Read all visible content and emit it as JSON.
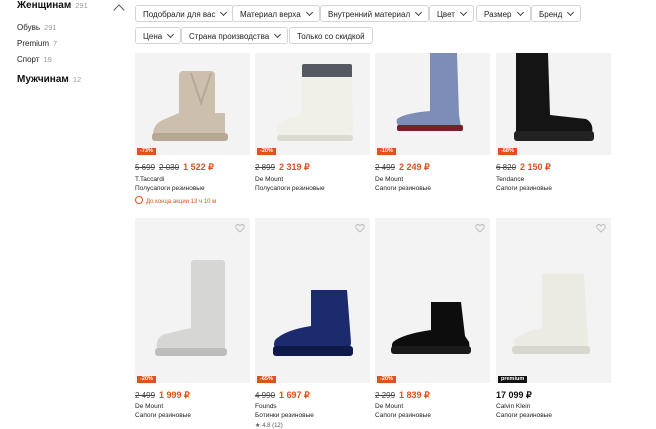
{
  "sidebar": {
    "women": {
      "label": "Женщинам",
      "count": "291"
    },
    "subcats": [
      {
        "label": "Обувь",
        "count": "291"
      },
      {
        "label": "Premium",
        "count": "7"
      },
      {
        "label": "Спорт",
        "count": "19"
      }
    ],
    "men": {
      "label": "Мужчинам",
      "count": "12"
    }
  },
  "filters": [
    {
      "label": "Подобрали для вас"
    },
    {
      "label": "Материал верха"
    },
    {
      "label": "Внутренний материал"
    },
    {
      "label": "Цвет"
    },
    {
      "label": "Размер"
    },
    {
      "label": "Бренд"
    },
    {
      "label": "Цена"
    },
    {
      "label": "Страна производства"
    },
    {
      "label": "Только со скидкой"
    }
  ],
  "products": [
    {
      "badge": "-73%",
      "old_price": "5 699",
      "mid_price": "2 030",
      "price": "1 522 ₽",
      "brand": "T.Taccardi",
      "type": "Полусапоги резиновые",
      "promo": "До конца акции 13 ч 10 м",
      "color": "#cdbfae"
    },
    {
      "badge": "-20%",
      "old_price": "2 899",
      "price": "2 319 ₽",
      "brand": "De Mount",
      "type": "Полусапоги резиновые",
      "color": "#f0efe8"
    },
    {
      "badge": "-10%",
      "old_price": "2 499",
      "price": "2 249 ₽",
      "brand": "De Mount",
      "type": "Сапоги резиновые",
      "color": "#7e8db8"
    },
    {
      "badge": "-68%",
      "old_price": "6 820",
      "price": "2 150 ₽",
      "brand": "Tendance",
      "type": "Сапоги резиновые",
      "color": "#141414"
    },
    {
      "badge": "-20%",
      "old_price": "2 499",
      "price": "1 999 ₽",
      "brand": "De Mount",
      "type": "Сапоги резиновые",
      "color": "#d6d6d4"
    },
    {
      "badge": "-65%",
      "old_price": "4 990",
      "price": "1 697 ₽",
      "brand": "Founds",
      "type": "Ботинки резиновые",
      "rating": "4.8",
      "reviews": "(12)",
      "color": "#1c2a6e"
    },
    {
      "badge": "-20%",
      "old_price": "2 299",
      "price": "1 839 ₽",
      "brand": "De Mount",
      "type": "Сапоги резиновые",
      "color": "#0d0d0d"
    },
    {
      "badge": "premium",
      "price": "17 099 ₽",
      "brand": "Calvin Klein",
      "type": "Сапоги резиновые",
      "color": "#ecebe3"
    }
  ],
  "icons": {
    "heart": "heart-icon",
    "chevron": "chevron-down-icon",
    "clock": "clock-icon",
    "star": "star-icon"
  },
  "colors": {
    "accent": "#e2501c",
    "chip_border": "#d4d4d4"
  }
}
